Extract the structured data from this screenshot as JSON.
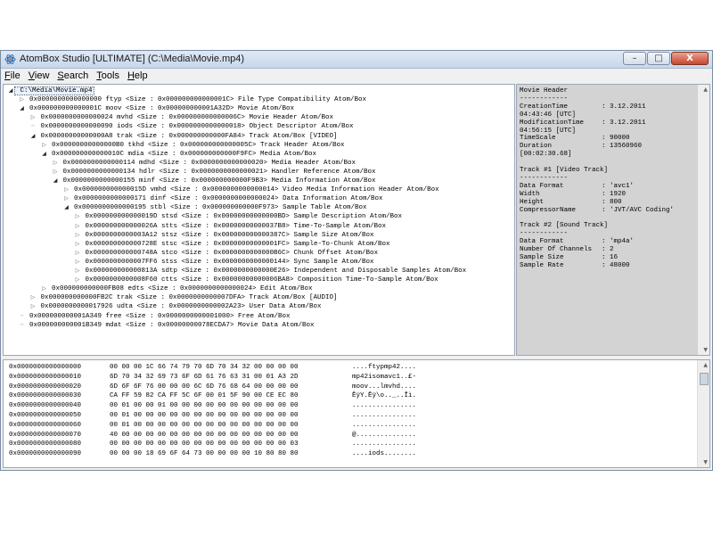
{
  "window": {
    "title": "AtomBox Studio [ULTIMATE] (C:\\Media\\Movie.mp4)",
    "caption_minimize": "–",
    "caption_maximize": "□",
    "caption_close": "X"
  },
  "menu": [
    {
      "underline": "F",
      "rest": "ile"
    },
    {
      "underline": "V",
      "rest": "iew"
    },
    {
      "underline": "S",
      "rest": "earch"
    },
    {
      "underline": "T",
      "rest": "ools"
    },
    {
      "underline": "H",
      "rest": "elp"
    }
  ],
  "tree": [
    {
      "depth": 0,
      "state": "expanded",
      "text": "C:\\Media\\Movie.mp4",
      "root": true
    },
    {
      "depth": 1,
      "state": "collapsed",
      "text": "0x0000000000000000 ftyp <Size : 0x000000000000001C> File Type Compatibility Atom/Box"
    },
    {
      "depth": 1,
      "state": "expanded",
      "text": "0x000000000000001C moov <Size : 0x000000000001A32D> Movie Atom/Box"
    },
    {
      "depth": 2,
      "state": "collapsed",
      "text": "0x0000000000000024 mvhd <Size : 0x000000000000006C> Movie Header Atom/Box"
    },
    {
      "depth": 2,
      "state": "leaf",
      "text": "0x0000000000000090 iods <Size : 0x0000000000000018> Object Descriptor Atom/Box"
    },
    {
      "depth": 2,
      "state": "expanded",
      "text": "0x00000000000000A8 trak <Size : 0x000000000000FA84> Track Atom/Box [VIDEO]"
    },
    {
      "depth": 3,
      "state": "collapsed",
      "text": "0x00000000000000B0 tkhd <Size : 0x000000000000005C> Track Header Atom/Box"
    },
    {
      "depth": 3,
      "state": "expanded",
      "text": "0x000000000000010C mdia <Size : 0x000000000000F9FC> Media Atom/Box"
    },
    {
      "depth": 4,
      "state": "collapsed",
      "text": "0x0000000000000114 mdhd <Size : 0x0000000000000020> Media Header Atom/Box"
    },
    {
      "depth": 4,
      "state": "collapsed",
      "text": "0x0000000000000134 hdlr <Size : 0x0000000000000021> Handler Reference Atom/Box"
    },
    {
      "depth": 4,
      "state": "expanded",
      "text": "0x0000000000000155 minf <Size : 0x000000000000F9B3> Media Information Atom/Box"
    },
    {
      "depth": 5,
      "state": "collapsed",
      "text": "0x000000000000015D vmhd <Size : 0x0000000000000014> Video Media Information Header Atom/Box"
    },
    {
      "depth": 5,
      "state": "collapsed",
      "text": "0x0000000000000171 dinf <Size : 0x0000000000000024> Data Information Atom/Box"
    },
    {
      "depth": 5,
      "state": "expanded",
      "text": "0x0000000000000195 stbl <Size : 0x000000000000F973> Sample Table Atom/Box"
    },
    {
      "depth": 6,
      "state": "collapsed",
      "text": "0x000000000000019D stsd <Size : 0x00000000000000BD> Sample Description Atom/Box"
    },
    {
      "depth": 6,
      "state": "collapsed",
      "text": "0x000000000000026A stts <Size : 0x00000000000037B8> Time-To-Sample Atom/Box"
    },
    {
      "depth": 6,
      "state": "collapsed",
      "text": "0x0000000000003A12 stsz <Size : 0x000000000000387C> Sample Size Atom/Box"
    },
    {
      "depth": 6,
      "state": "collapsed",
      "text": "0x000000000000728E stsc <Size : 0x00000000000001FC> Sample-To-Chunk Atom/Box"
    },
    {
      "depth": 6,
      "state": "collapsed",
      "text": "0x000000000000748A stco <Size : 0x0000000000000B6C> Chunk Offset Atom/Box"
    },
    {
      "depth": 6,
      "state": "collapsed",
      "text": "0x0000000000007FF6 stss <Size : 0x0000000000000144> Sync Sample Atom/Box"
    },
    {
      "depth": 6,
      "state": "collapsed",
      "text": "0x000000000000813A sdtp <Size : 0x0000000000000E26> Independent and Disposable Samples Atom/Box"
    },
    {
      "depth": 6,
      "state": "collapsed",
      "text": "0x0000000000008F60 ctts <Size : 0x00000000000006BA8> Composition Time-To-Sample Atom/Box"
    },
    {
      "depth": 3,
      "state": "collapsed",
      "text": "0x000000000000FB08 edts <Size : 0x0000000000000024> Edit Atom/Box"
    },
    {
      "depth": 2,
      "state": "collapsed",
      "text": "0x000000000000FB2C trak <Size : 0x0000000000007DFA> Track Atom/Box [AUDIO]"
    },
    {
      "depth": 2,
      "state": "collapsed",
      "text": "0x0000000000017926 udta <Size : 0x0000000000002A23> User Data Atom/Box"
    },
    {
      "depth": 1,
      "state": "leaf",
      "text": "0x000000000001A349 free <Size : 0x0000000000001000> Free Atom/Box"
    },
    {
      "depth": 1,
      "state": "leaf",
      "text": "0x000000000001B349 mdat <Size : 0x00000000078ECDA7> Movie Data Atom/Box"
    }
  ],
  "info": [
    {
      "key": "Movie Header",
      "value": ""
    },
    {
      "key": "------------",
      "value": ""
    },
    {
      "key": "CreationTime",
      "value": ": 3.12.2011"
    },
    {
      "key": "04:43:46 [UTC]",
      "value": ""
    },
    {
      "key": "ModificationTime",
      "value": ": 3.12.2011"
    },
    {
      "key": "04:56:15 [UTC]",
      "value": ""
    },
    {
      "key": "TimeScale",
      "value": ": 90000"
    },
    {
      "key": "Duration",
      "value": ": 13560960"
    },
    {
      "key": "[00:02:30.68]",
      "value": ""
    },
    {
      "key": "",
      "value": ""
    },
    {
      "key": "Track #1 [Video Track]",
      "value": ""
    },
    {
      "key": "------------",
      "value": ""
    },
    {
      "key": "Data Format",
      "value": ": 'avc1'"
    },
    {
      "key": "Width",
      "value": ": 1920"
    },
    {
      "key": "Height",
      "value": ": 800"
    },
    {
      "key": "CompressorName",
      "value": ": 'JVT/AVC Coding'"
    },
    {
      "key": "",
      "value": ""
    },
    {
      "key": "Track #2 [Sound Track]",
      "value": ""
    },
    {
      "key": "------------",
      "value": ""
    },
    {
      "key": "Data Format",
      "value": ": 'mp4a'"
    },
    {
      "key": "Number Of Channels",
      "value": ": 2"
    },
    {
      "key": "Sample Size",
      "value": ": 16"
    },
    {
      "key": "Sample Rate",
      "value": ": 48000"
    }
  ],
  "hex": [
    {
      "offset": "0x0000000000000000",
      "bytes": "00 00 00 1C 66 74 79 70 6D 70 34 32 00 00 00 00",
      "ascii": "....ftypmp42...."
    },
    {
      "offset": "0x0000000000000010",
      "bytes": "6D 70 34 32 69 73 6F 6D 61 76 63 31 00 01 A3 2D",
      "ascii": "mp42isomavc1..£-"
    },
    {
      "offset": "0x0000000000000020",
      "bytes": "6D 6F 6F 76 00 00 00 6C 6D 76 68 64 00 00 00 00",
      "ascii": "moov...lmvhd...."
    },
    {
      "offset": "0x0000000000000030",
      "bytes": "CA FF 59 82 CA FF 5C 6F 00 01 5F 90 00 CE EC 80",
      "ascii": "ÊÿY.Êÿ\\o.._..Îì."
    },
    {
      "offset": "0x0000000000000040",
      "bytes": "00 01 00 00 01 00 00 00 00 00 00 00 00 00 00 00",
      "ascii": "................"
    },
    {
      "offset": "0x0000000000000050",
      "bytes": "00 01 00 00 00 00 00 00 00 00 00 00 00 00 00 00",
      "ascii": "................"
    },
    {
      "offset": "0x0000000000000060",
      "bytes": "00 01 00 00 00 00 00 00 00 00 00 00 00 00 00 00",
      "ascii": "................"
    },
    {
      "offset": "0x0000000000000070",
      "bytes": "40 00 00 00 00 00 00 00 00 00 00 00 00 00 00 00",
      "ascii": "@..............."
    },
    {
      "offset": "0x0000000000000080",
      "bytes": "00 00 00 00 00 00 00 00 00 00 00 00 00 00 00 03",
      "ascii": "................"
    },
    {
      "offset": "0x0000000000000090",
      "bytes": "00 00 00 18 69 6F 64 73 00 00 00 00 10 80 80 80",
      "ascii": "....iods........"
    }
  ]
}
